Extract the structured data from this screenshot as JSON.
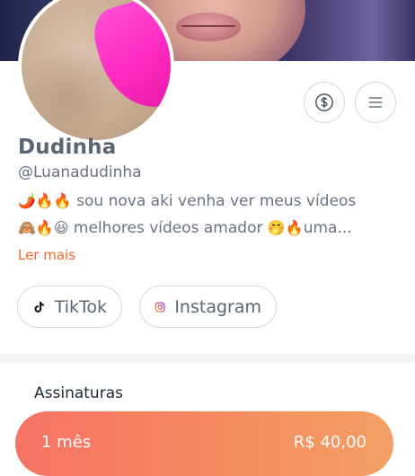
{
  "profile": {
    "name": "Dudinha",
    "handle": "@Luanadudinha",
    "bio_line1_emoji": "🌶️🔥🔥",
    "bio_line1_text": " sou nova aki venha ver meus vídeos",
    "bio_line2_emoji": "🙈🔥😆",
    "bio_line2_text": " melhores vídeos amador ",
    "bio_line2_emoji2": "🤭🔥",
    "bio_line2_tail": "uma...",
    "read_more": "Ler mais"
  },
  "actions": {
    "tip_icon": "dollar-circle-icon",
    "menu_icon": "hamburger-menu-icon"
  },
  "social": [
    {
      "label": "TikTok",
      "icon": "tiktok-icon"
    },
    {
      "label": "Instagram",
      "icon": "instagram-icon"
    }
  ],
  "subscriptions": {
    "title": "Assinaturas",
    "plans": [
      {
        "period": "1 mês",
        "price": "R$ 40,00"
      }
    ]
  },
  "colors": {
    "accent_link": "#f06a2e",
    "plan_gradient_start": "#f67365",
    "plan_gradient_end": "#f2a065"
  }
}
